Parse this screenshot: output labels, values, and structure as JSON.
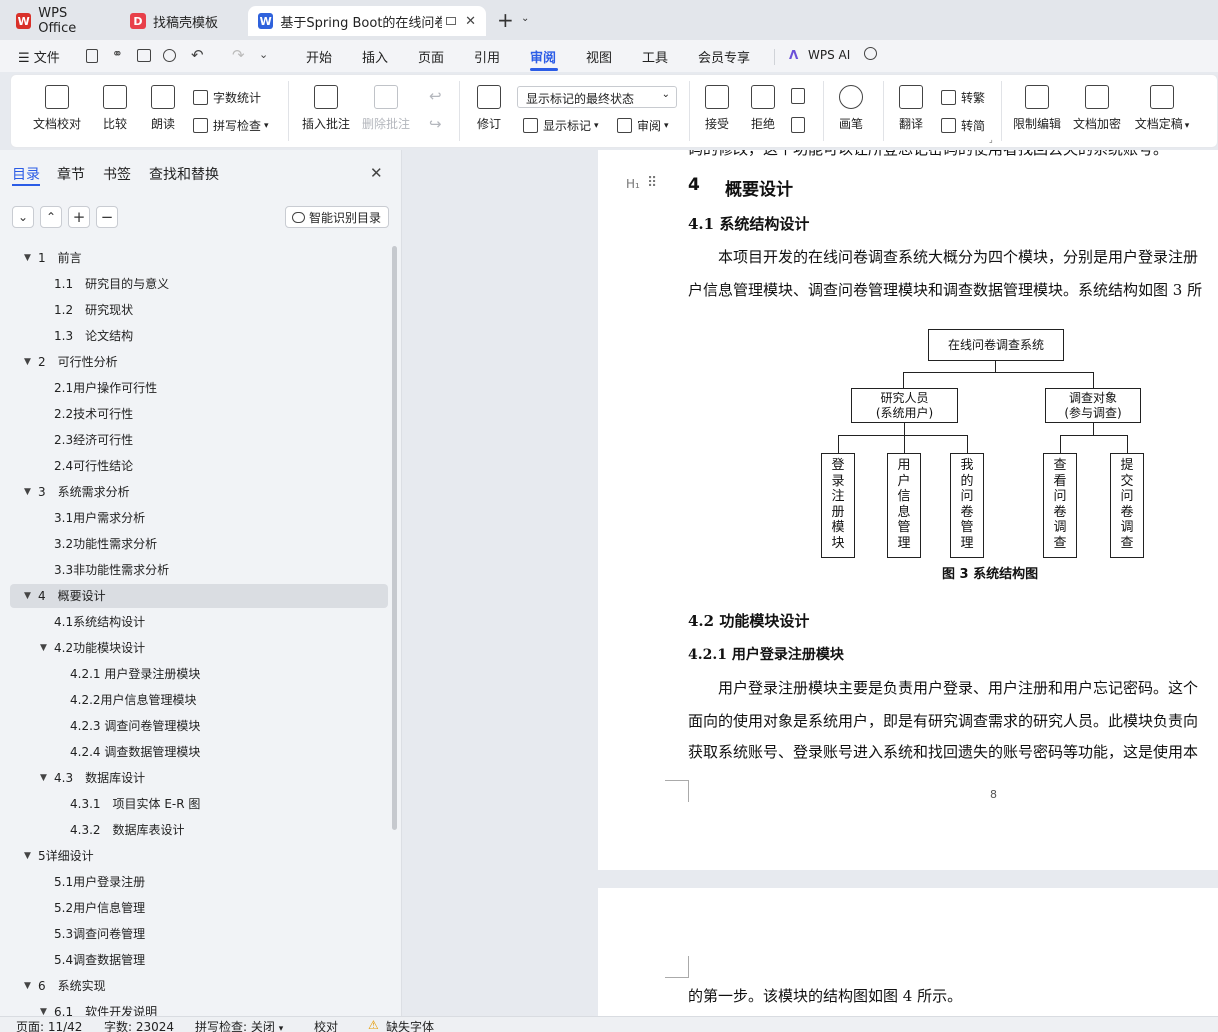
{
  "tabs": [
    {
      "label": "WPS Office",
      "icon": "wps-logo-icon",
      "color": "#d9312a"
    },
    {
      "label": "找稿壳模板",
      "icon": "template-logo-icon",
      "color": "#e8404a"
    },
    {
      "label": "基于Spring Boot的在线问卷",
      "icon": "word-logo-icon",
      "color": "#2f62dc"
    }
  ],
  "menu": {
    "file": "文件",
    "items": [
      "开始",
      "插入",
      "页面",
      "引用",
      "审阅",
      "视图",
      "工具",
      "会员专享"
    ],
    "active": "审阅",
    "ai": "WPS AI",
    "active_color": "#2b5ce6"
  },
  "ribbon": {
    "doc_check": "文档校对",
    "compare": "比较",
    "read_aloud": "朗读",
    "word_count": "字数统计",
    "spell_check": "拼写检查",
    "insert_comment": "插入批注",
    "delete_comment": "删除批注",
    "revise": "修订",
    "markup_state": "显示标记的最终状态",
    "show_markup": "显示标记",
    "review": "审阅",
    "accept": "接受",
    "reject": "拒绝",
    "pen": "画笔",
    "translate": "翻译",
    "trad": "转繁",
    "simp": "转简",
    "restrict_edit": "限制编辑",
    "encrypt": "文档加密",
    "finalize": "文档定稿"
  },
  "sidebar": {
    "tabs": [
      "目录",
      "章节",
      "书签",
      "查找和替换"
    ],
    "smart_btn": "智能识别目录",
    "toc": [
      {
        "label": "1　前言",
        "level": 0,
        "expanded": true
      },
      {
        "label": "1.1　研究目的与意义",
        "level": 1
      },
      {
        "label": "1.2　研究现状",
        "level": 1
      },
      {
        "label": "1.3　论文结构",
        "level": 1
      },
      {
        "label": "2　可行性分析",
        "level": 0,
        "expanded": true
      },
      {
        "label": "2.1用户操作可行性",
        "level": 1
      },
      {
        "label": "2.2技术可行性",
        "level": 1
      },
      {
        "label": "2.3经济可行性",
        "level": 1
      },
      {
        "label": "2.4可行性结论",
        "level": 1
      },
      {
        "label": "3　系统需求分析",
        "level": 0,
        "expanded": true
      },
      {
        "label": "3.1用户需求分析",
        "level": 1
      },
      {
        "label": "3.2功能性需求分析",
        "level": 1
      },
      {
        "label": "3.3非功能性需求分析",
        "level": 1
      },
      {
        "label": "4　概要设计",
        "level": 0,
        "expanded": true,
        "selected": true
      },
      {
        "label": "4.1系统结构设计",
        "level": 1
      },
      {
        "label": "4.2功能模块设计",
        "level": 1,
        "expanded": true
      },
      {
        "label": "4.2.1 用户登录注册模块",
        "level": 2
      },
      {
        "label": "4.2.2用户信息管理模块",
        "level": 2
      },
      {
        "label": "4.2.3 调查问卷管理模块",
        "level": 2
      },
      {
        "label": "4.2.4 调查数据管理模块",
        "level": 2
      },
      {
        "label": "4.3　数据库设计",
        "level": 1,
        "expanded": true
      },
      {
        "label": "4.3.1　项目实体 E-R 图",
        "level": 2
      },
      {
        "label": "4.3.2　数据库表设计",
        "level": 2
      },
      {
        "label": "5详细设计",
        "level": 0,
        "expanded": true
      },
      {
        "label": "5.1用户登录注册",
        "level": 1
      },
      {
        "label": "5.2用户信息管理",
        "level": 1
      },
      {
        "label": "5.3调查问卷管理",
        "level": 1
      },
      {
        "label": "5.4调查数据管理",
        "level": 1
      },
      {
        "label": "6　系统实现",
        "level": 0,
        "expanded": true
      },
      {
        "label": "6.1　软件开发说明",
        "level": 1,
        "expanded": true
      }
    ]
  },
  "doc": {
    "top_fragment": "码的修改，这个功能可以让所登忘记密码的使用者找回丢失的系统账号。",
    "h1_num": "4",
    "h1_text": "概要设计",
    "h2_a": "4.1  系统结构设计",
    "para1_l1": "本项目开发的在线问卷调查系统大概分为四个模块，分别是用户登录注册",
    "para1_l2": "户信息管理模块、调查问卷管理模块和调查数据管理模块。系统结构如图 3 所",
    "diagram": {
      "root": "在线问卷调查系统",
      "left_node": "研究人员\n(系统用户)",
      "right_node": "调查对象\n(参与调查)",
      "leaves": [
        "登录注册模块",
        "用户信息管理",
        "我的问卷管理",
        "查看问卷调查",
        "提交问卷调查"
      ]
    },
    "caption": "图 3  系统结构图",
    "h2_b": "4.2  功能模块设计",
    "h3": "4.2.1  用户登录注册模块",
    "para2_l1": "用户登录注册模块主要是负责用户登录、用户注册和用户忘记密码。这个",
    "para2_l2": "面向的使用对象是系统用户，即是有研究调查需求的研究人员。此模块负责向",
    "para2_l3": "获取系统账号、登录账号进入系统和找回遗失的账号密码等功能，这是使用本",
    "page_num": "8",
    "page2_text": "的第一步。该模块的结构图如图 4 所示。"
  },
  "status": {
    "page": "页面: 11/42",
    "words": "字数: 23024",
    "spell": "拼写检查: 关闭",
    "proof": "校对",
    "missing_font": "缺失字体"
  }
}
